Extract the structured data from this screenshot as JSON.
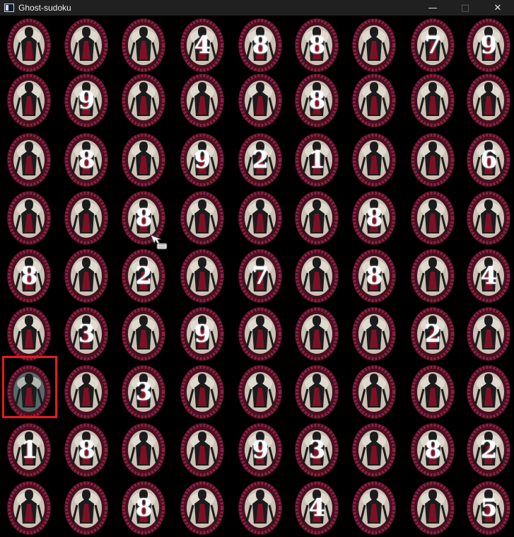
{
  "window": {
    "title": "Ghost-sudoku",
    "minimize_icon": "minimize-icon",
    "maximize_icon": "maximize-icon",
    "close_icon": "close-icon"
  },
  "board": {
    "selected": {
      "row": 6,
      "col": 0
    },
    "rows": [
      [
        "",
        "",
        "",
        "4",
        "8",
        "8",
        "",
        "7",
        "9"
      ],
      [
        "",
        "9",
        "",
        "",
        "",
        "8",
        "",
        "",
        ""
      ],
      [
        "",
        "8",
        "",
        "9",
        "2",
        "1",
        "",
        "",
        "6"
      ],
      [
        "",
        "",
        "8",
        "",
        "",
        "",
        "8",
        "",
        ""
      ],
      [
        "8",
        "",
        "2",
        "",
        "7",
        "",
        "8",
        "",
        "4"
      ],
      [
        "",
        "3",
        "",
        "9",
        "",
        "",
        "",
        "2",
        ""
      ],
      [
        "",
        "",
        "3",
        "",
        "",
        "",
        "",
        "",
        ""
      ],
      [
        "1",
        "8",
        "",
        "",
        "9",
        "3",
        "",
        "8",
        "2"
      ],
      [
        "",
        "",
        "8",
        "",
        "",
        "4",
        "",
        "",
        "5"
      ]
    ]
  },
  "colors": {
    "background": "#000000",
    "frame": "#8c2240",
    "frame_dark": "#4a0f22",
    "portrait_bg": "#c9c2b4",
    "ghost": "#1b1b1b",
    "ghost_red": "#7d1026",
    "selection": "#e8191b"
  }
}
